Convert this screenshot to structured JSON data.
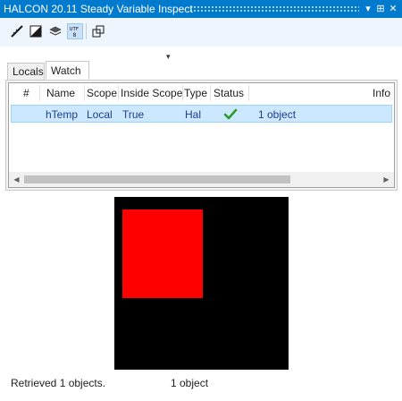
{
  "window": {
    "title": "HALCON 20.11 Steady Variable Inspect",
    "menu_glyph": "▾",
    "pin_glyph": "⊞",
    "close_glyph": "✕"
  },
  "toolbar": {
    "overflow_glyph": "▾",
    "icons": [
      "measure-icon",
      "contrast-icon",
      "layers-icon",
      "utf8-icon",
      "channels-icon"
    ]
  },
  "tabs": [
    {
      "label": "Locals",
      "active": false
    },
    {
      "label": "Watch",
      "active": true
    }
  ],
  "table": {
    "columns": [
      "#",
      "Name",
      "Scope",
      "Inside Scope",
      "Type",
      "Status",
      "Info"
    ],
    "rows": [
      {
        "num": "",
        "name": "hTemp",
        "scope": "Local",
        "inside_scope": "True",
        "type": "Hal",
        "status": "ok",
        "info": "1 object"
      }
    ]
  },
  "scrollbar": {
    "left_glyph": "◀",
    "right_glyph": "▶"
  },
  "colors": {
    "accent": "#007acc",
    "selection": "#cce8ff",
    "check": "#2e9a2e",
    "region": "#ff0000",
    "background": "#000000"
  },
  "status": {
    "left": "Retrieved 1 objects.",
    "right": "1 object"
  }
}
